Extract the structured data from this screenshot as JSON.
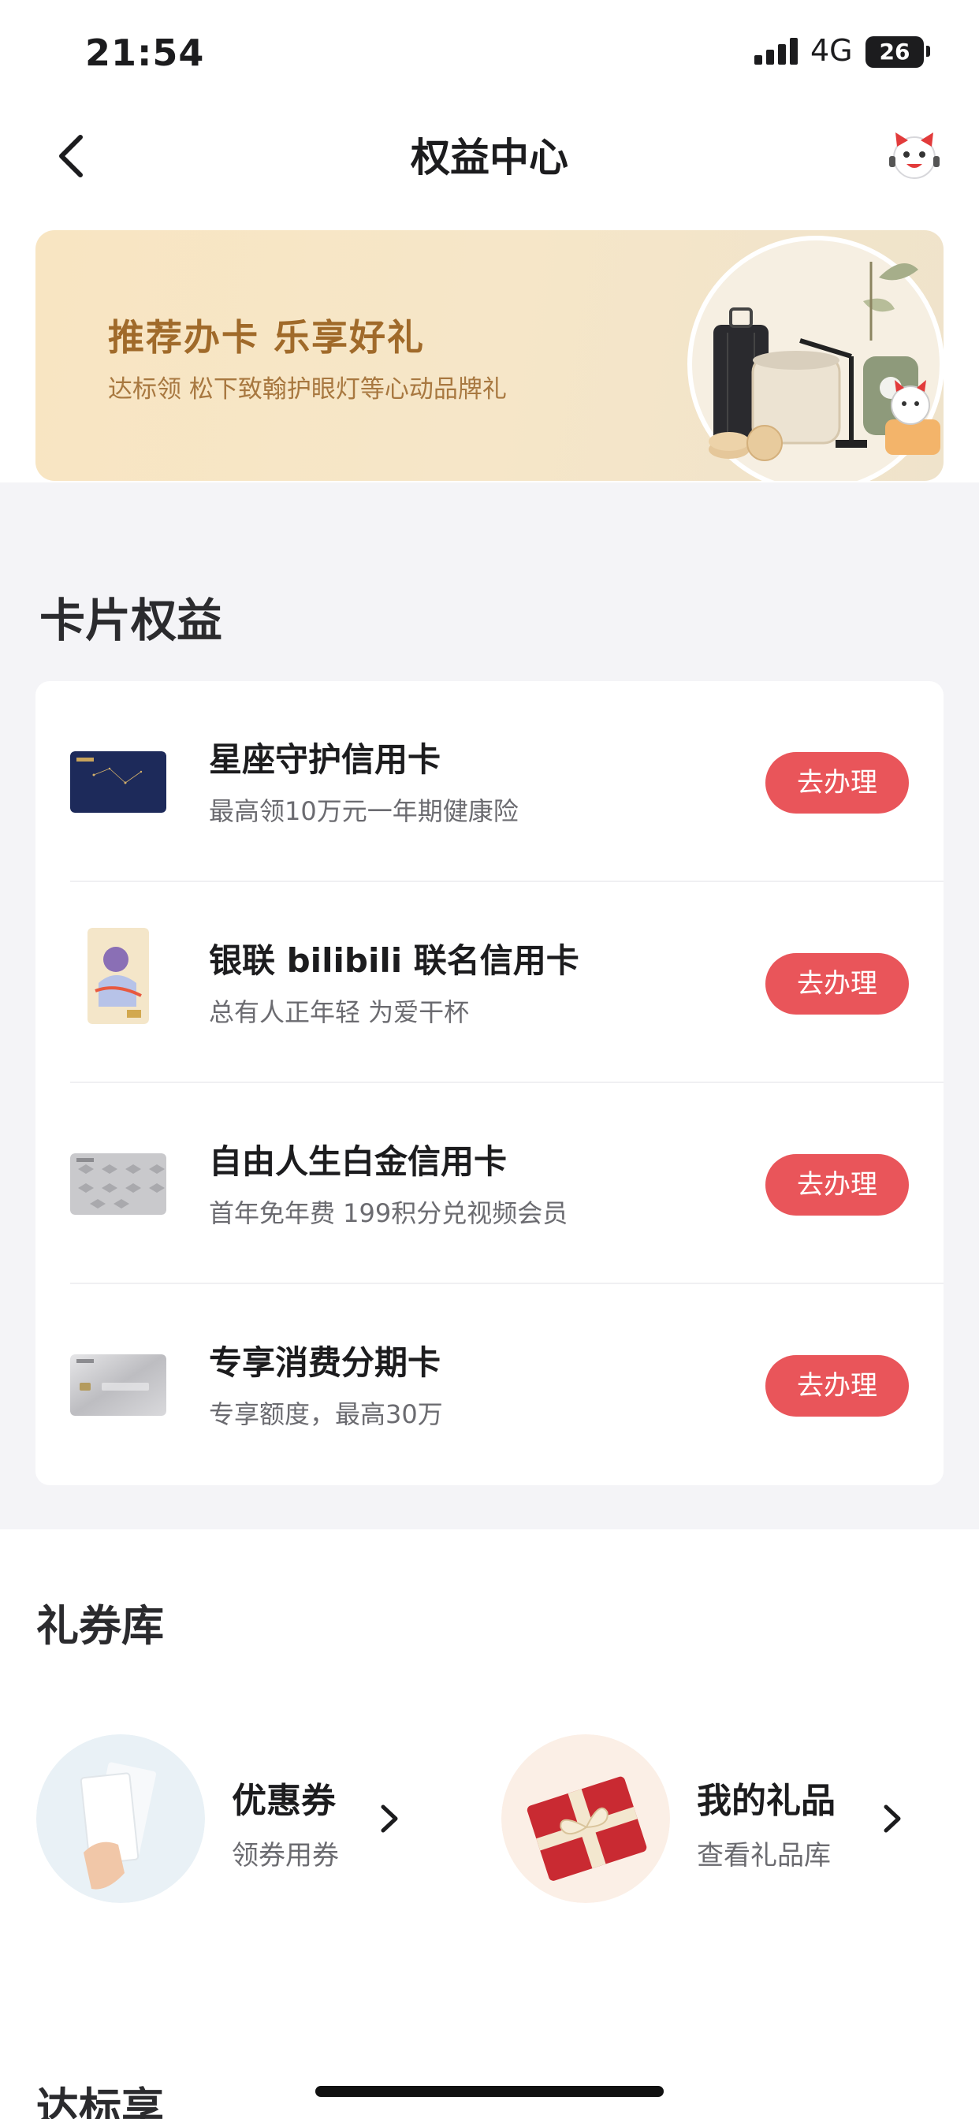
{
  "status_bar": {
    "time": "21:54",
    "network": "4G",
    "battery": "26"
  },
  "nav": {
    "title": "权益中心",
    "back_icon": "chevron-left-icon",
    "avatar_icon": "mascot-avatar-icon"
  },
  "banner": {
    "title": "推荐办卡 乐享好礼",
    "subtitle": "达标领 松下致翰护眼灯等心动品牌礼",
    "colors": {
      "background": "#f8e5c2",
      "text": "#a06a2a"
    }
  },
  "card_benefits": {
    "title": "卡片权益",
    "cards": [
      {
        "name": "星座守护信用卡",
        "desc": "最高领10万元一年期健康险",
        "button": "去办理",
        "thumb": "navy-card"
      },
      {
        "name": "银联 bilibili 联名信用卡",
        "desc": "总有人正年轻 为爱干杯",
        "button": "去办理",
        "thumb": "bilibili-card"
      },
      {
        "name": "自由人生白金信用卡",
        "desc": "首年免年费 199积分兑视频会员",
        "button": "去办理",
        "thumb": "silver-pattern-card"
      },
      {
        "name": "专享消费分期卡",
        "desc": "专享额度，最高30万",
        "button": "去办理",
        "thumb": "silver-card"
      }
    ],
    "accent_color": "#e9555a"
  },
  "coupon_library": {
    "title": "礼券库",
    "tiles": [
      {
        "title": "优惠券",
        "subtitle": "领券用券",
        "icon": "coupon-hand-icon"
      },
      {
        "title": "我的礼品",
        "subtitle": "查看礼品库",
        "icon": "gift-box-icon"
      }
    ]
  },
  "next_section": {
    "title": "达标享"
  }
}
